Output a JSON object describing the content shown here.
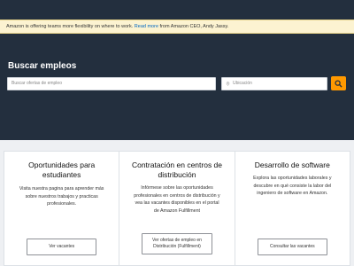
{
  "banner": {
    "text_before": "Amazon is offering teams more flexibility on where to work.",
    "link": "Read more",
    "text_after": "from Amazon CEO, Andy Jassy."
  },
  "search": {
    "title": "Buscar empleos",
    "keyword_placeholder": "Buscar ofertas de empleo",
    "location_placeholder": "Ubicación"
  },
  "cards": [
    {
      "title": "Oportunidades para estudiantes",
      "text": "Visita nuestra pagina para aprender más sobre nuestros trabajos y practicas profesionales.",
      "button": "Ver vacantes"
    },
    {
      "title": "Contratación en centros de distribución",
      "text": "Infórmese sobre las oportunidades profesionales en centros de distribución y vea las vacantes disponibles en el portal de Amazon Fulfillment",
      "button": "Ver ofertas de empleo en Distribución (Fulfillment)"
    },
    {
      "title": "Desarrollo de software",
      "text": "Explora las oportunidades laborales y descubre en qué consiste la labor del ingeniero de software en Amazon.",
      "button": "Consultar las vacantes"
    }
  ],
  "colors": {
    "navy": "#232f3e",
    "accent": "#ff9900",
    "banner_bg": "#fcf3d1",
    "link": "#0066c0"
  },
  "icons": {
    "location": "map-pin-icon",
    "search": "search-icon"
  }
}
